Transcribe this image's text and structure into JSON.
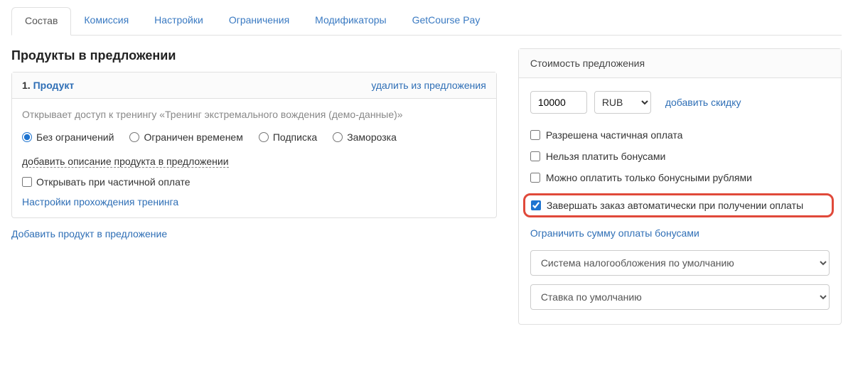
{
  "tabs": {
    "items": [
      {
        "label": "Состав",
        "active": true
      },
      {
        "label": "Комиссия"
      },
      {
        "label": "Настройки"
      },
      {
        "label": "Ограничения"
      },
      {
        "label": "Модификаторы"
      },
      {
        "label": "GetCourse Pay"
      }
    ]
  },
  "left": {
    "section_title": "Продукты в предложении",
    "product": {
      "index": "1.",
      "name": "Продукт",
      "remove": "удалить из предложения",
      "description": "Открывает доступ к тренингу «Тренинг экстремального вождения (демо-данные)»",
      "limit_options": [
        "Без ограничений",
        "Ограничен временем",
        "Подписка",
        "Заморозка"
      ],
      "add_desc": "добавить описание продукта в предложении",
      "partial_open_label": "Открывать при частичной оплате",
      "training_settings": "Настройки прохождения тренинга"
    },
    "add_product": "Добавить продукт в предложение"
  },
  "right": {
    "title": "Стоимость предложения",
    "price_value": "10000",
    "currency": "RUB",
    "discount_label": "добавить скидку",
    "checks": {
      "partial_pay": "Разрешена частичная оплата",
      "no_bonus": "Нельзя платить бонусами",
      "only_bonus": "Можно оплатить только бонусными рублями",
      "auto_complete": "Завершать заказ автоматически при получении оплаты"
    },
    "bonus_limit_link": "Ограничить сумму оплаты бонусами",
    "tax_system": "Система налогообложения по умолчанию",
    "tax_rate": "Ставка по умолчанию"
  }
}
